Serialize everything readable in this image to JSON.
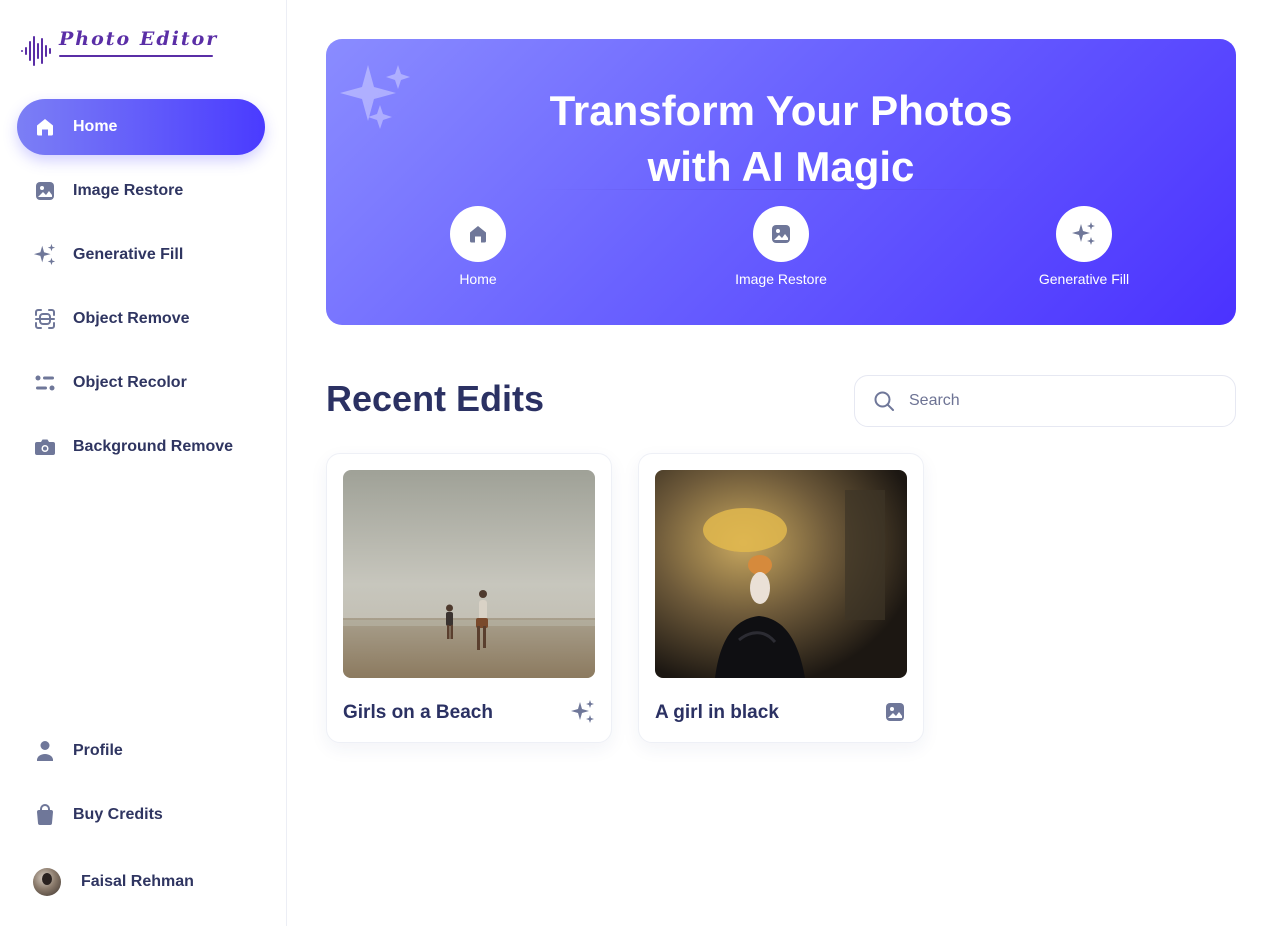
{
  "app": {
    "name": "Photo Editor"
  },
  "colors": {
    "accent_start": "#7c7ff5",
    "accent_end": "#4a3bff",
    "text_primary": "#2b3163",
    "icon_muted": "#6f7799",
    "logo": "#5a2ea6"
  },
  "sidebar": {
    "items": [
      {
        "label": "Home",
        "icon": "home-icon",
        "active": true
      },
      {
        "label": "Image Restore",
        "icon": "image-icon",
        "active": false
      },
      {
        "label": "Generative Fill",
        "icon": "sparkles-icon",
        "active": false
      },
      {
        "label": "Object Remove",
        "icon": "scan-icon",
        "active": false
      },
      {
        "label": "Object Recolor",
        "icon": "sliders-icon",
        "active": false
      },
      {
        "label": "Background Remove",
        "icon": "camera-icon",
        "active": false
      }
    ],
    "bottom_items": [
      {
        "label": "Profile",
        "icon": "user-icon"
      },
      {
        "label": "Buy Credits",
        "icon": "bag-icon"
      }
    ],
    "user": {
      "name": "Faisal Rehman"
    }
  },
  "hero": {
    "title_line1": "Transform Your Photos",
    "title_line2": "with AI Magic",
    "actions": [
      {
        "label": "Home",
        "icon": "home-icon"
      },
      {
        "label": "Image Restore",
        "icon": "image-icon"
      },
      {
        "label": "Generative Fill",
        "icon": "sparkles-icon"
      }
    ]
  },
  "recent": {
    "title": "Recent Edits",
    "search_placeholder": "Search",
    "cards": [
      {
        "name": "Girls on a Beach",
        "icon": "sparkles-icon"
      },
      {
        "name": "A girl in black",
        "icon": "image-icon"
      }
    ]
  }
}
